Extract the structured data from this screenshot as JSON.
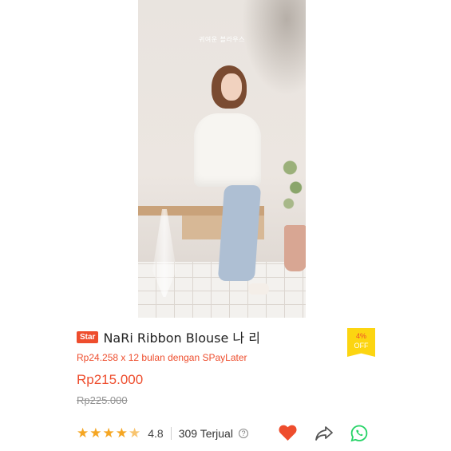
{
  "product_image": {
    "caption": "귀여운 블라우스"
  },
  "badge": {
    "label": "Star"
  },
  "product": {
    "title": "NaRi Ribbon Blouse 나 리",
    "paylater": "Rp24.258 x 12 bulan dengan SPayLater",
    "price": "Rp215.000",
    "original_price": "Rp225.000"
  },
  "discount": {
    "percent": "4%",
    "off": "OFF"
  },
  "rating": {
    "value": "4.8",
    "stars": 4.8
  },
  "sold": {
    "label": "309 Terjual"
  },
  "icons": {
    "help": "?",
    "favorite": "heart-icon",
    "share": "share-icon",
    "whatsapp": "whatsapp-icon"
  },
  "colors": {
    "accent": "#ee4d2d",
    "star": "#f5a623",
    "discount_bg": "#fcd511",
    "whatsapp": "#25d366",
    "heart": "#ee4d2d"
  }
}
